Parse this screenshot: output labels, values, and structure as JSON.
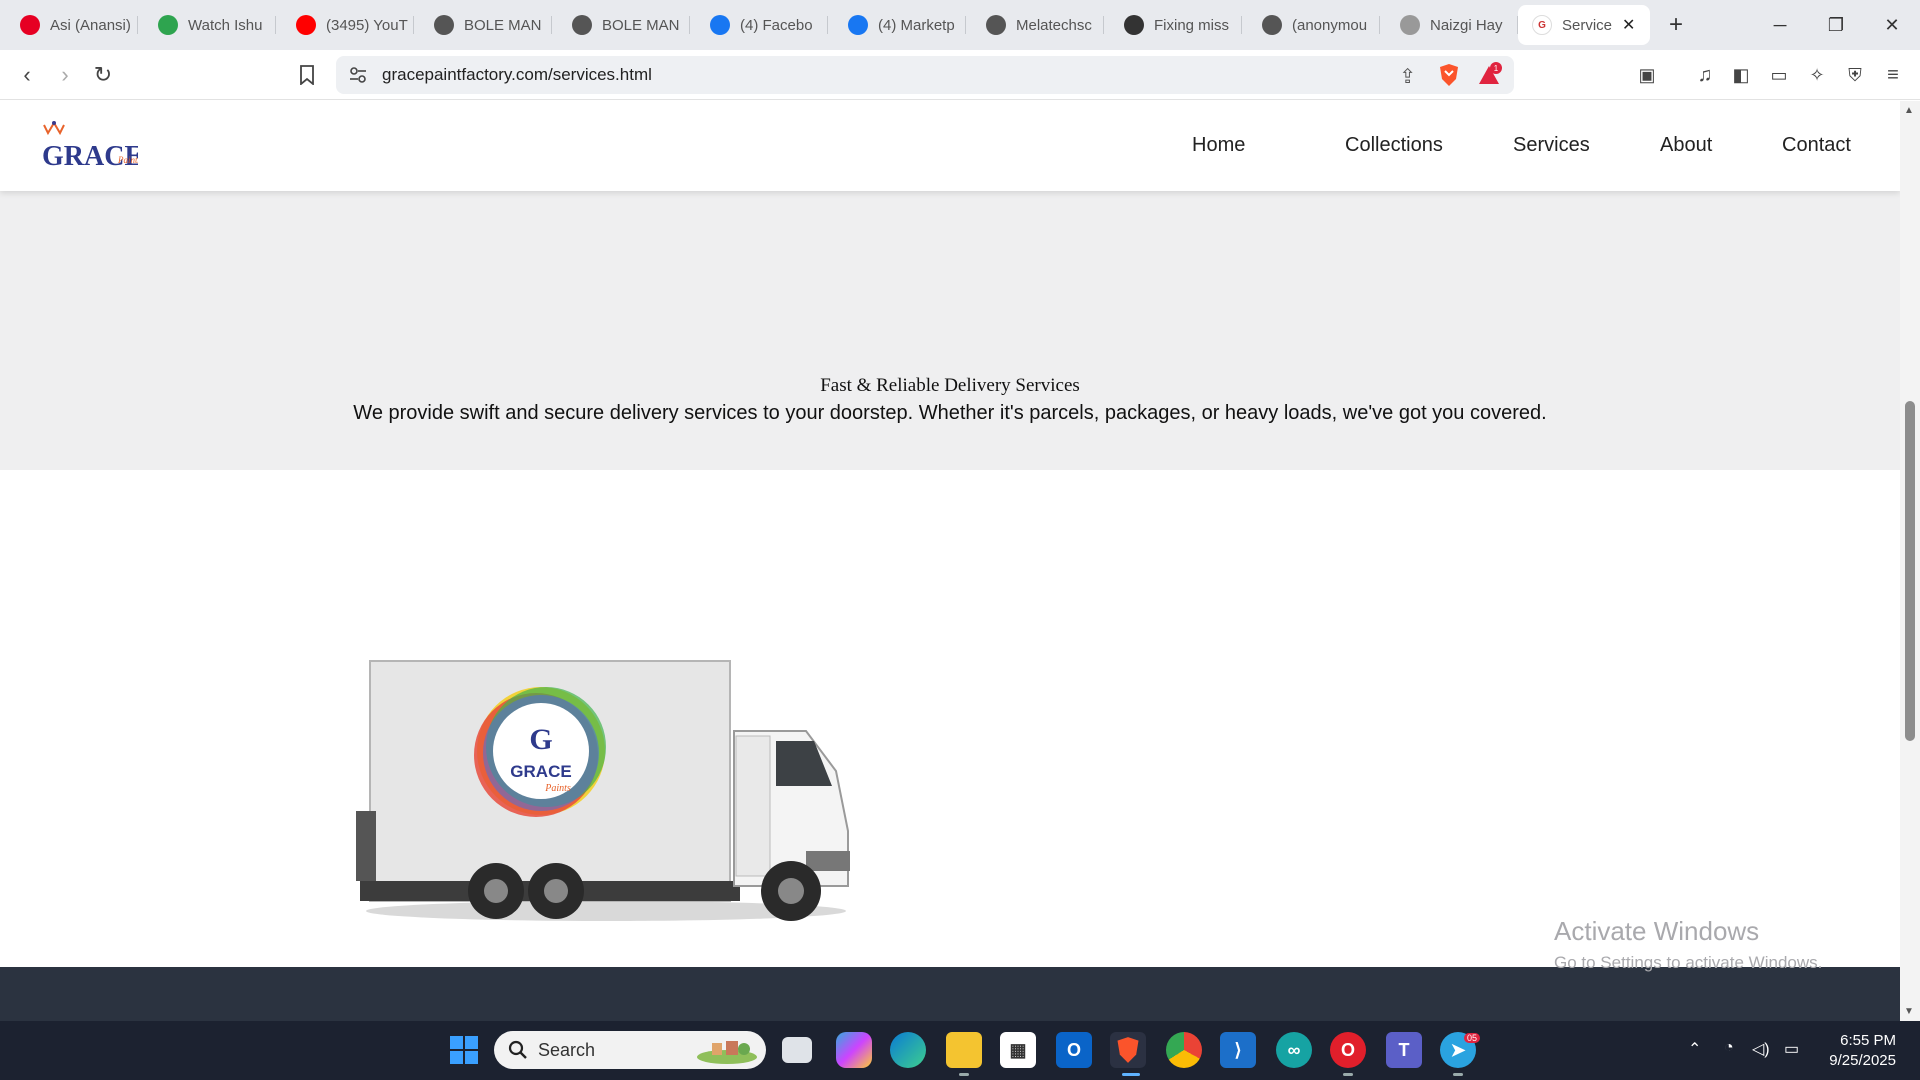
{
  "browser": {
    "tabs": [
      {
        "title": "Asi (Anansi)",
        "icon": "pinterest-icon",
        "color": "#e60023"
      },
      {
        "title": "Watch Ishu",
        "icon": "play-icon",
        "color": "#2ea44f"
      },
      {
        "title": "(3495) YouT",
        "icon": "youtube-icon",
        "color": "#ff0000"
      },
      {
        "title": "BOLE MAN",
        "icon": "globe-icon",
        "color": "#555555"
      },
      {
        "title": "BOLE MAN",
        "icon": "globe-icon",
        "color": "#555555"
      },
      {
        "title": "(4) Facebo",
        "icon": "facebook-icon",
        "color": "#1877f2"
      },
      {
        "title": "(4) Marketp",
        "icon": "facebook-icon",
        "color": "#1877f2"
      },
      {
        "title": "Melatechsc",
        "icon": "globe-icon",
        "color": "#555555"
      },
      {
        "title": "Fixing miss",
        "icon": "openai-icon",
        "color": "#333333"
      },
      {
        "title": "(anonymou",
        "icon": "globe-icon",
        "color": "#555555"
      },
      {
        "title": "Naizgi Hay",
        "icon": "page-icon",
        "color": "#999999"
      }
    ],
    "active_tab": {
      "title": "Service",
      "icon": "grace-favicon"
    },
    "url": "gracepaintfactory.com/services.html",
    "rewards_badge": "1"
  },
  "site": {
    "nav": {
      "home": "Home",
      "collections": "Collections",
      "services": "Services",
      "about": "About",
      "contact": "Contact"
    },
    "logo_text": "GRACE",
    "logo_sub": "Paints",
    "service": {
      "title": "Fast & Reliable Delivery Services",
      "description": "We provide swift and secure delivery services to your doorstep. Whether it's parcels, packages, or heavy loads, we've got you covered."
    },
    "truck_logo_text": "GRACE",
    "truck_logo_sub": "Paints",
    "truck_logo_letter": "G"
  },
  "watermark": {
    "line1": "Activate Windows",
    "line2": "Go to Settings to activate Windows."
  },
  "taskbar": {
    "search_placeholder": "Search",
    "telegram_badge": "05",
    "time": "6:55 PM",
    "date": "9/25/2025"
  },
  "colors": {
    "footer": "#2b3340",
    "band": "#efeff0",
    "taskbar": "#1c2230"
  }
}
